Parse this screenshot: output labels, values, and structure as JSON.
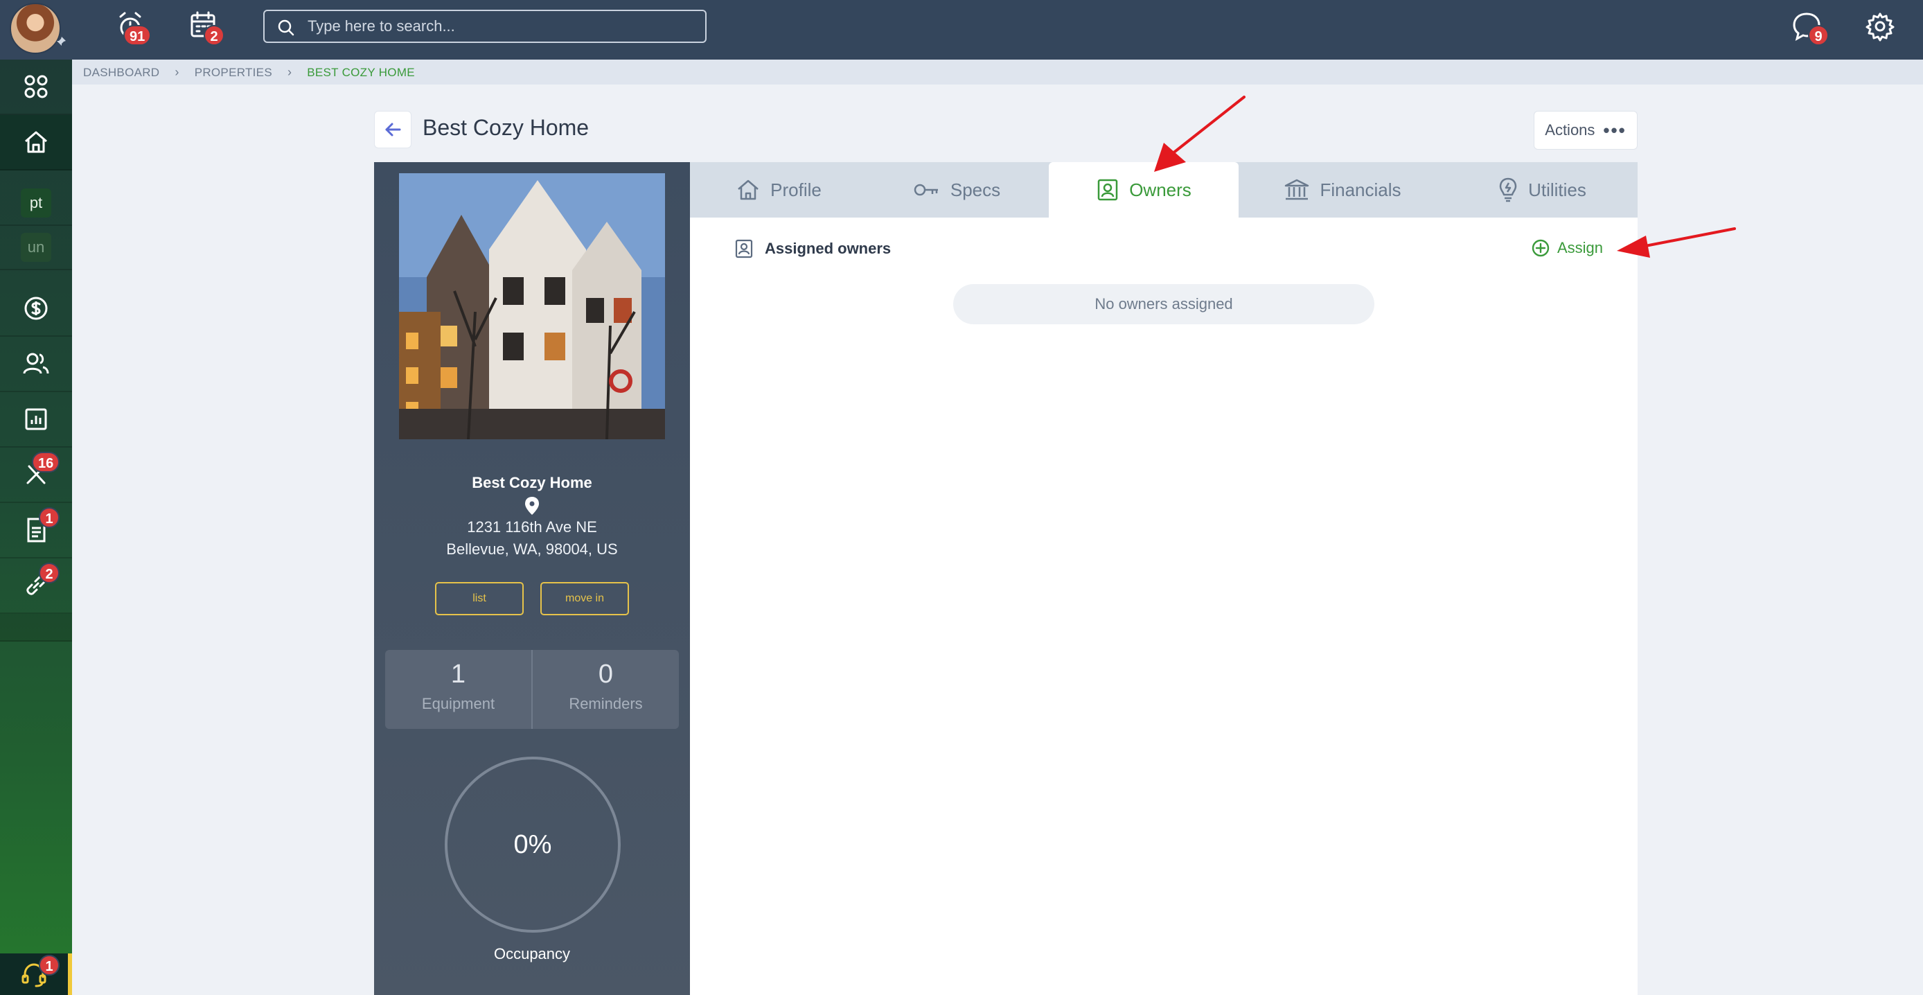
{
  "topbar": {
    "alerts_badge": "91",
    "calendar_badge": "2",
    "search_placeholder": "Type here to search...",
    "messages_badge": "9"
  },
  "sidebar": {
    "items": [
      {
        "icon": "apps-grid-icon"
      },
      {
        "icon": "home-icon",
        "active": true
      },
      {
        "tag": "pt"
      },
      {
        "tag": "un"
      },
      {
        "icon": "dollar-icon"
      },
      {
        "icon": "people-icon"
      },
      {
        "icon": "report-chart-icon"
      },
      {
        "icon": "tools-icon",
        "badge": "16"
      },
      {
        "icon": "document-icon",
        "badge": "1"
      },
      {
        "icon": "link-icon",
        "badge": "2"
      }
    ],
    "support_badge": "1"
  },
  "breadcrumb": {
    "items": [
      "DASHBOARD",
      "PROPERTIES"
    ],
    "current": "BEST COZY HOME"
  },
  "page": {
    "title": "Best Cozy Home",
    "actions_label": "Actions"
  },
  "property": {
    "name": "Best Cozy Home",
    "address_line1": "1231 116th Ave NE",
    "address_line2": "Bellevue, WA, 98004, US",
    "list_label": "list",
    "move_in_label": "move in",
    "equipment_count": "1",
    "equipment_label": "Equipment",
    "reminders_count": "0",
    "reminders_label": "Reminders",
    "occupancy_value": "0%",
    "occupancy_label": "Occupancy"
  },
  "tabs": [
    {
      "label": "Profile",
      "icon": "home-outline-icon"
    },
    {
      "label": "Specs",
      "icon": "key-icon"
    },
    {
      "label": "Owners",
      "icon": "owner-badge-icon",
      "active": true
    },
    {
      "label": "Financials",
      "icon": "bank-icon"
    },
    {
      "label": "Utilities",
      "icon": "bulb-icon"
    }
  ],
  "owners": {
    "heading": "Assigned owners",
    "assign_label": "Assign",
    "empty_text": "No owners assigned"
  },
  "colors": {
    "topbar": "#34465c",
    "accent_green": "#3a9a3a",
    "badge_red": "#d93b3b",
    "pill_yellow": "#e6c34a",
    "annotation_arrow": "#e3191f"
  }
}
